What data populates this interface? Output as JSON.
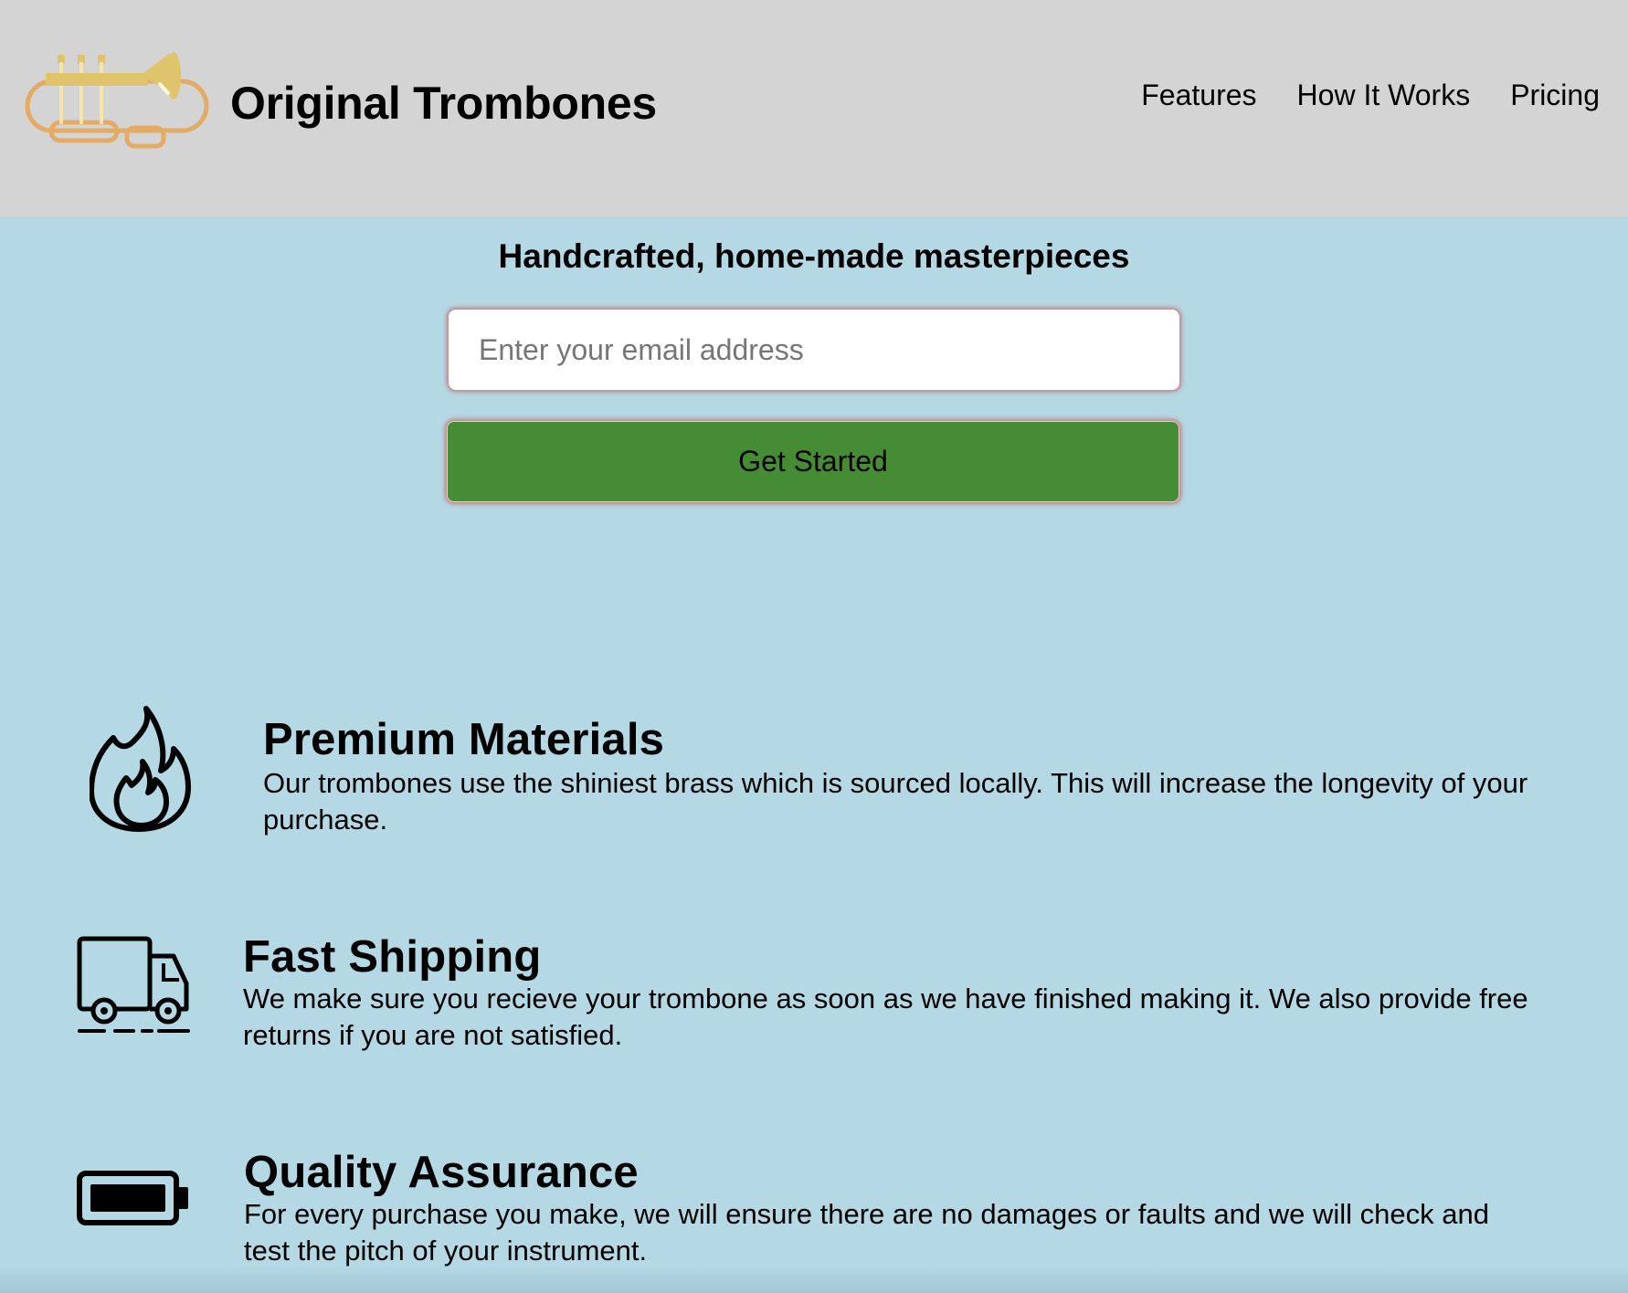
{
  "header": {
    "brand": "Original Trombones",
    "logo_icon": "trumpet-logo-icon",
    "nav": [
      {
        "label": "Features"
      },
      {
        "label": "How It Works"
      },
      {
        "label": "Pricing"
      }
    ]
  },
  "hero": {
    "title": "Handcrafted, home-made masterpieces",
    "email_placeholder": "Enter your email address",
    "email_value": "",
    "cta_label": "Get Started"
  },
  "features": [
    {
      "icon": "fire-icon",
      "title": "Premium Materials",
      "description": "Our trombones use the shiniest brass which is sourced locally. This will increase the longevity of your purchase."
    },
    {
      "icon": "truck-icon",
      "title": "Fast Shipping",
      "description": "We make sure you recieve your trombone as soon as we have finished making it. We also provide free returns if you are not satisfied."
    },
    {
      "icon": "battery-icon",
      "title": "Quality Assurance",
      "description": "For every purchase you make, we will ensure there are no damages or faults and we will check and test the pitch of your instrument."
    }
  ],
  "colors": {
    "header_bg": "#d4d4d4",
    "page_bg": "#b4d8e4",
    "cta_bg": "#468c34",
    "logo_gold": "#e0c46c",
    "logo_orange": "#e3ab64"
  }
}
